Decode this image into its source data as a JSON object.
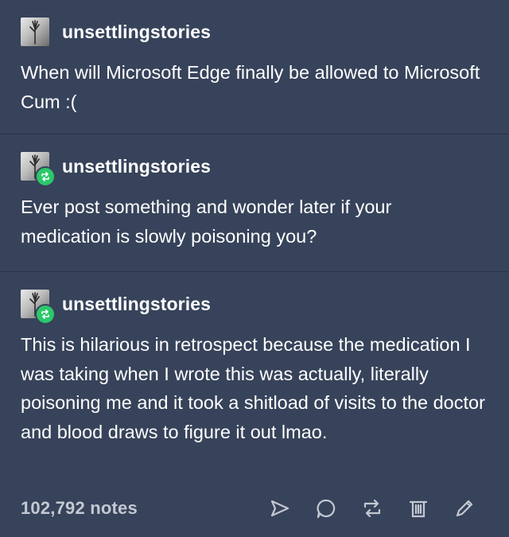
{
  "posts": [
    {
      "username": "unsettlingstories",
      "is_reblog": false,
      "body": "When will Microsoft Edge finally be allowed to Microsoft Cum :("
    },
    {
      "username": "unsettlingstories",
      "is_reblog": true,
      "body": "Ever post something and wonder later if your medication is slowly poisoning you?"
    },
    {
      "username": "unsettlingstories",
      "is_reblog": true,
      "body": "This is hilarious in retrospect because the medication I was taking when I wrote this was actually, literally poisoning me and it took a shitload of visits to the doctor and blood draws to figure it out lmao."
    }
  ],
  "footer": {
    "notes": "102,792 notes",
    "actions": [
      "share-icon",
      "reply-icon",
      "reblog-icon",
      "delete-icon",
      "edit-icon"
    ]
  },
  "colors": {
    "background": "#37435a",
    "divider": "#2b3446",
    "reblog_badge": "#2bc86a",
    "notes_text": "#c3c8d2"
  }
}
